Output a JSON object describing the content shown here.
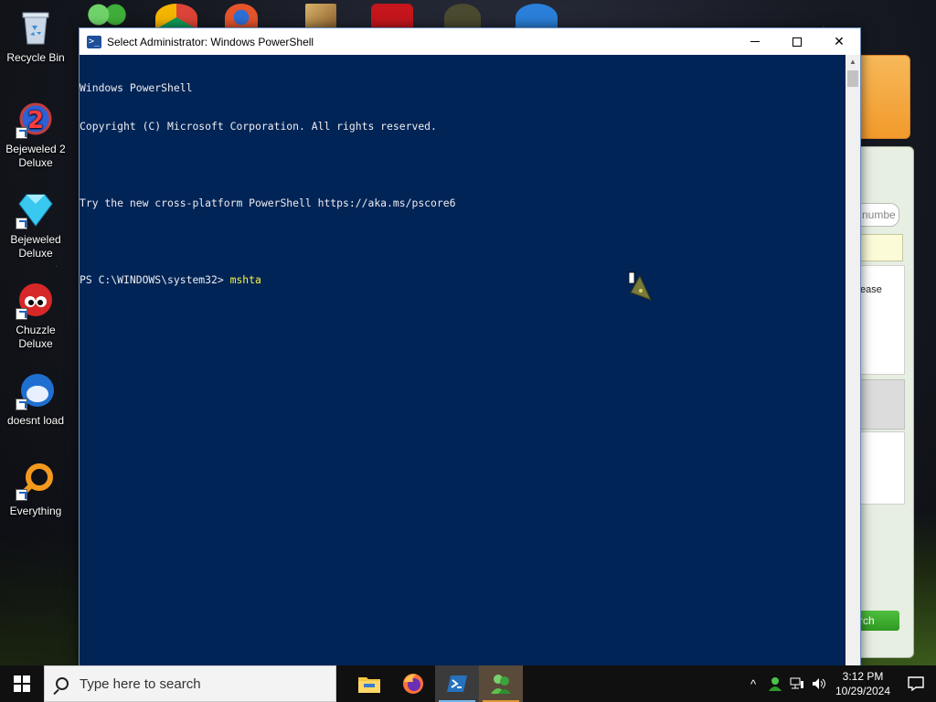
{
  "desktop": {
    "icons": [
      {
        "label": "Recycle Bin",
        "icon": "recycle-bin-icon"
      },
      {
        "label": "Bejeweled 2\nDeluxe",
        "icon": "bejeweled-2-icon"
      },
      {
        "label": "Bejeweled\nDeluxe",
        "icon": "bejeweled-gem-icon"
      },
      {
        "label": "Chuzzle\nDeluxe",
        "icon": "chuzzle-icon"
      },
      {
        "label": "doesnt load",
        "icon": "thunderbird-icon"
      },
      {
        "label": "Everything",
        "icon": "everything-search-icon"
      }
    ]
  },
  "powershell": {
    "title": "Select Administrator: Windows PowerShell",
    "lines": [
      "Windows PowerShell",
      "Copyright (C) Microsoft Corporation. All rights reserved.",
      "",
      "Try the new cross-platform PowerShell https://aka.ms/pscore6",
      ""
    ],
    "prompt": "PS C:\\WINDOWS\\system32> ",
    "command": "mshta",
    "colors": {
      "background": "#012456",
      "text": "#eeedf0",
      "command": "#f5f543"
    }
  },
  "background_window": {
    "field_placeholder": "numbe",
    "text_fragment": "ease",
    "button_fragment": "rch"
  },
  "taskbar": {
    "search_placeholder": "Type here to search",
    "apps": [
      "file-explorer-icon",
      "firefox-icon",
      "powershell-icon",
      "users-green-icon"
    ],
    "clock_time": "3:12 PM",
    "clock_date": "10/29/2024"
  }
}
